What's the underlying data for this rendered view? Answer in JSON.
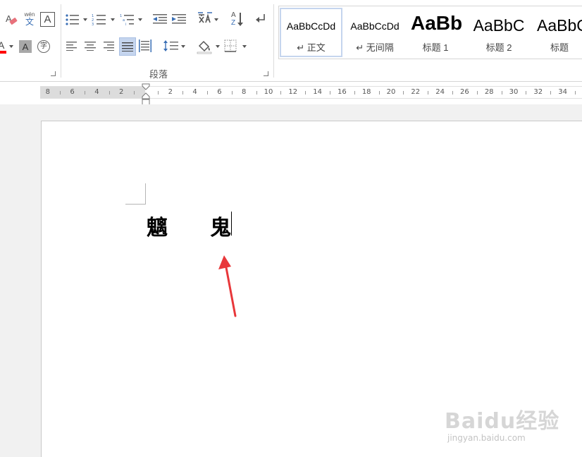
{
  "ribbon": {
    "paragraph_group_label": "段落",
    "phonetic_guide_label": "wén",
    "phonetic_guide_char": "文",
    "char_border_glyph": "A",
    "char_shading_glyph": "A",
    "enclose_char_glyph": "字",
    "clear_format_glyph": "A",
    "font_color_glyph": "A",
    "font_color": "#ff0000",
    "sort_glyph_top": "A",
    "sort_glyph_bottom": "Z",
    "styles": [
      {
        "preview": "AaBbCcDd",
        "name": "↵ 正文",
        "selected": true
      },
      {
        "preview": "AaBbCcDd",
        "name": "↵ 无间隔",
        "selected": false
      },
      {
        "preview": "AaBb",
        "name": "标题 1",
        "selected": false
      },
      {
        "preview": "AaBbC",
        "name": "标题 2",
        "selected": false
      },
      {
        "preview": "AaBbC",
        "name": "标题",
        "selected": false
      }
    ]
  },
  "ruler": {
    "left_labels": [
      "8",
      "6",
      "4",
      "2"
    ],
    "right_labels": [
      "2",
      "4",
      "6",
      "8",
      "10",
      "12",
      "14",
      "16",
      "18",
      "20",
      "22",
      "24",
      "26",
      "28",
      "30",
      "32",
      "34"
    ]
  },
  "document": {
    "text_chars": [
      "魑",
      "鬼"
    ]
  },
  "annotation": {
    "arrow_color": "#e8373a"
  },
  "watermark": {
    "brand": "Baidu经验",
    "url": "jingyan.baidu.com"
  }
}
